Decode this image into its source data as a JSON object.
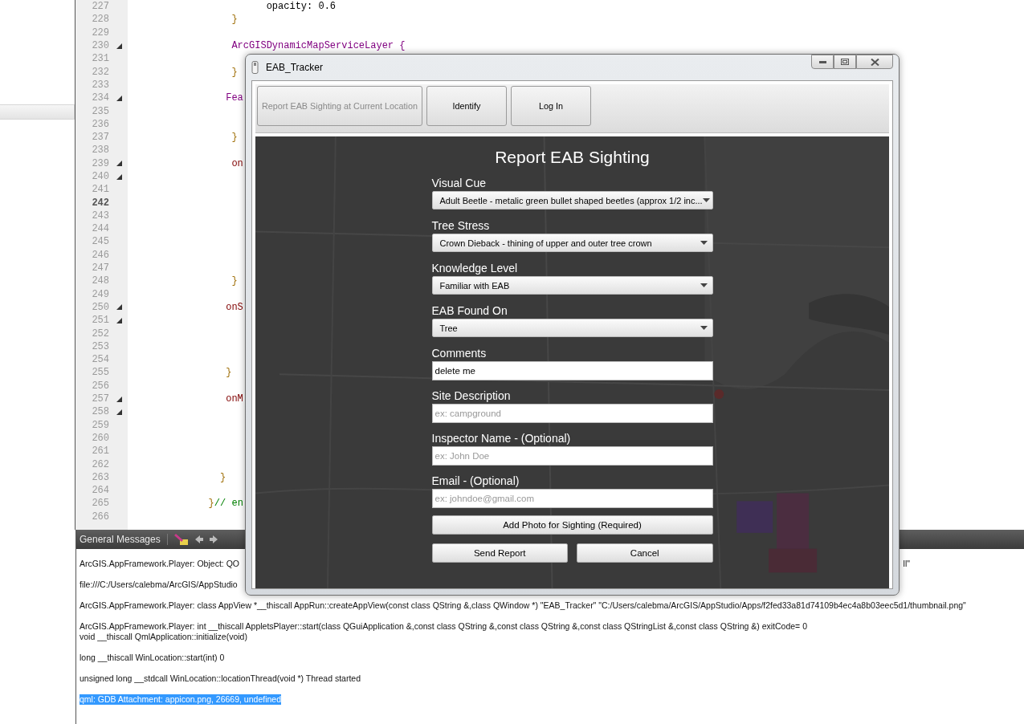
{
  "editor": {
    "lines": [
      {
        "number": "227",
        "fold": false,
        "current": false,
        "segments": [
          {
            "text": "                       opacity: 0.6",
            "kind": "plain"
          }
        ]
      },
      {
        "number": "228",
        "fold": false,
        "current": false,
        "segments": [
          {
            "text": "                 }",
            "kind": "brace"
          }
        ]
      },
      {
        "number": "229",
        "fold": false,
        "current": false
      },
      {
        "number": "230",
        "fold": true,
        "current": false,
        "segments": [
          {
            "text": "                 ArcGISDynamicMapServiceLayer {",
            "kind": "type"
          }
        ]
      },
      {
        "number": "231",
        "fold": false,
        "current": false
      },
      {
        "number": "232",
        "fold": false,
        "current": false,
        "segments": [
          {
            "text": "                 }",
            "kind": "brace"
          }
        ]
      },
      {
        "number": "233",
        "fold": false,
        "current": false
      },
      {
        "number": "234",
        "fold": true,
        "current": false,
        "segments": [
          {
            "text": "                Fea",
            "kind": "type"
          }
        ]
      },
      {
        "number": "235",
        "fold": false,
        "current": false
      },
      {
        "number": "236",
        "fold": false,
        "current": false
      },
      {
        "number": "237",
        "fold": false,
        "current": false,
        "segments": [
          {
            "text": "                 }",
            "kind": "brace"
          }
        ]
      },
      {
        "number": "238",
        "fold": false,
        "current": false
      },
      {
        "number": "239",
        "fold": true,
        "current": false,
        "segments": [
          {
            "text": "                 on",
            "kind": "handler"
          }
        ]
      },
      {
        "number": "240",
        "fold": true,
        "current": false
      },
      {
        "number": "241",
        "fold": false,
        "current": false
      },
      {
        "number": "242",
        "fold": false,
        "current": true
      },
      {
        "number": "243",
        "fold": false,
        "current": false
      },
      {
        "number": "244",
        "fold": false,
        "current": false
      },
      {
        "number": "245",
        "fold": false,
        "current": false
      },
      {
        "number": "246",
        "fold": false,
        "current": false
      },
      {
        "number": "247",
        "fold": false,
        "current": false
      },
      {
        "number": "248",
        "fold": false,
        "current": false,
        "segments": [
          {
            "text": "                 }",
            "kind": "brace"
          }
        ]
      },
      {
        "number": "249",
        "fold": false,
        "current": false
      },
      {
        "number": "250",
        "fold": true,
        "current": false,
        "segments": [
          {
            "text": "                onS",
            "kind": "handler"
          }
        ]
      },
      {
        "number": "251",
        "fold": true,
        "current": false
      },
      {
        "number": "252",
        "fold": false,
        "current": false
      },
      {
        "number": "253",
        "fold": false,
        "current": false
      },
      {
        "number": "254",
        "fold": false,
        "current": false
      },
      {
        "number": "255",
        "fold": false,
        "current": false,
        "segments": [
          {
            "text": "                }",
            "kind": "brace"
          }
        ]
      },
      {
        "number": "256",
        "fold": false,
        "current": false
      },
      {
        "number": "257",
        "fold": true,
        "current": false,
        "segments": [
          {
            "text": "                onM",
            "kind": "handler"
          }
        ]
      },
      {
        "number": "258",
        "fold": true,
        "current": false
      },
      {
        "number": "259",
        "fold": false,
        "current": false
      },
      {
        "number": "260",
        "fold": false,
        "current": false
      },
      {
        "number": "261",
        "fold": false,
        "current": false
      },
      {
        "number": "262",
        "fold": false,
        "current": false
      },
      {
        "number": "263",
        "fold": false,
        "current": false,
        "segments": [
          {
            "text": "               }",
            "kind": "brace"
          }
        ]
      },
      {
        "number": "264",
        "fold": false,
        "current": false
      },
      {
        "number": "265",
        "fold": false,
        "current": false,
        "segments": [
          {
            "text": "             }",
            "kind": "brace"
          },
          {
            "text": "// en",
            "kind": "comment"
          }
        ]
      },
      {
        "number": "266",
        "fold": false,
        "current": false
      }
    ]
  },
  "messages_panel": {
    "title": "General Messages",
    "messages": [
      {
        "lines": [
          "ArcGIS.AppFramework.Player: Object: QO"
        ],
        "tail": "ll\"",
        "selected": false
      },
      {
        "lines": [
          "file:///C:/Users/calebma/ArcGIS/AppStudio"
        ],
        "selected": false
      },
      {
        "lines": [
          "ArcGIS.AppFramework.Player: class AppView *__thiscall AppRun::createAppView(const class QString &,class QWindow *) \"EAB_Tracker\" \"C:/Users/calebma/ArcGIS/AppStudio/Apps/f2fed33a81d74109b4ec4a8b03eec5d1/thumbnail.png\""
        ],
        "selected": false
      },
      {
        "lines": [
          "ArcGIS.AppFramework.Player: int __thiscall AppletsPlayer::start(class QGuiApplication &,const class QString &,const class QString &,const class QStringList &,const class QString &) exitCode= 0",
          "void __thiscall QmlApplication::initialize(void)"
        ],
        "selected": false
      },
      {
        "lines": [
          "long __thiscall WinLocation::start(int) 0"
        ],
        "selected": false
      },
      {
        "lines": [
          "unsigned long __stdcall WinLocation::locationThread(void *) Thread started"
        ],
        "selected": false
      },
      {
        "lines": [
          "qml: GDB Attachment: appicon.png, 26669, undefined"
        ],
        "selected": true
      }
    ]
  },
  "window": {
    "title": "EAB_Tracker",
    "toolbar": [
      {
        "label": "Report EAB Sighting at Current Location",
        "disabled": true
      },
      {
        "label": "Identify",
        "disabled": false
      },
      {
        "label": "Log In",
        "disabled": false
      }
    ],
    "form": {
      "title": "Report EAB Sighting",
      "fields": [
        {
          "label": "Visual Cue",
          "kind": "dropdown",
          "value": "Adult Beetle - metalic green bullet shaped beetles (approx 1/2 inc..."
        },
        {
          "label": "Tree Stress",
          "kind": "dropdown",
          "value": "Crown Dieback - thining of upper and outer tree crown"
        },
        {
          "label": "Knowledge Level",
          "kind": "dropdown",
          "value": "Familiar with EAB"
        },
        {
          "label": "EAB Found On",
          "kind": "dropdown",
          "value": "Tree"
        },
        {
          "label": "Comments",
          "kind": "text",
          "value": "delete me"
        },
        {
          "label": "Site Description",
          "kind": "text",
          "placeholder": "ex: campground"
        },
        {
          "label": "Inspector Name - (Optional)",
          "kind": "text",
          "placeholder": "ex: John Doe"
        },
        {
          "label": "Email - (Optional)",
          "kind": "text",
          "placeholder": "ex: johndoe@gmail.com"
        }
      ],
      "photo_button": "Add Photo for Sighting (Required)",
      "buttons": [
        "Send Report",
        "Cancel"
      ]
    }
  }
}
